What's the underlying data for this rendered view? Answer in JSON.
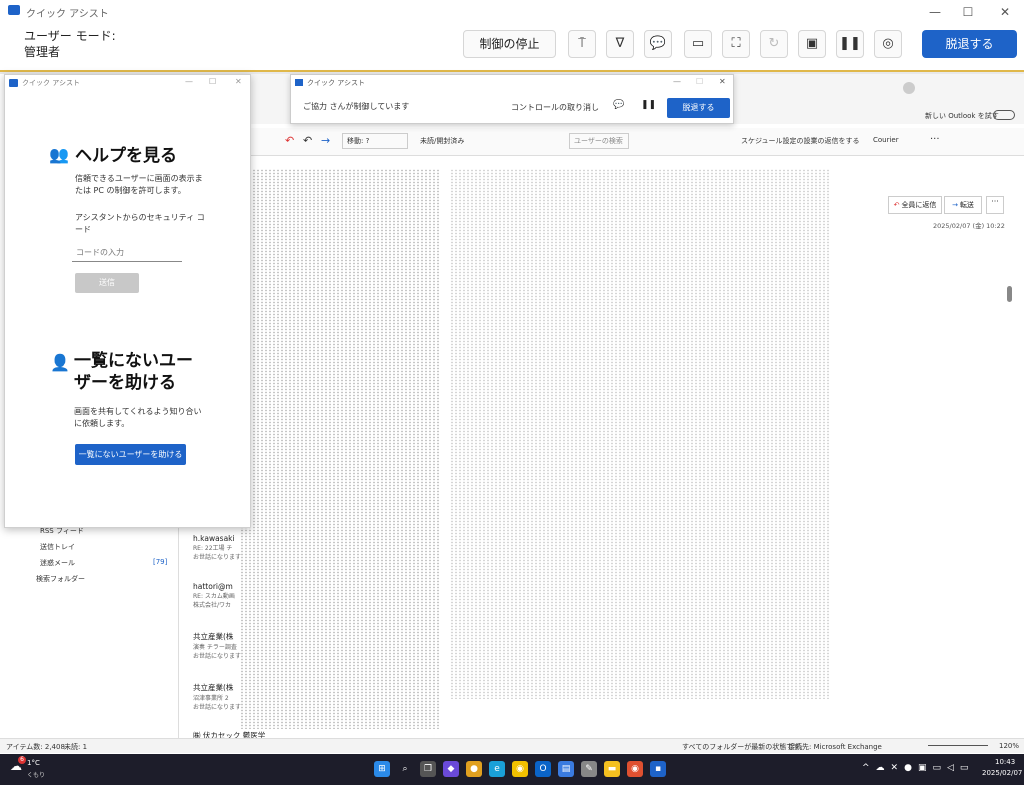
{
  "top_window": {
    "title": "クイック アシスト",
    "mode_label": "ユーザー モード:",
    "mode_value": "管理者",
    "stop_control": "制御の停止",
    "leave": "脱退する"
  },
  "help_panel": {
    "title": "クイック アシスト",
    "help_heading": "ヘルプを見る",
    "help_desc": "信頼できるユーザーに画面の表示または PC の制御を許可します。",
    "code_label": "アシスタントからのセキュリティ コード",
    "code_placeholder": "コードの入力",
    "submit": "送信",
    "unlisted_heading": "一覧にないユーザーを助ける",
    "unlisted_desc": "画面を共有してくれるよう知り合いに依頼します。",
    "unlisted_button": "一覧にないユーザーを助ける"
  },
  "inner_bar": {
    "title": "クイック アシスト",
    "status": "ご協力 さんが制御しています",
    "cancel_control": "コントロールの取り消し",
    "leave": "脱退する"
  },
  "outlook": {
    "try_new": "新しい Outlook を試す",
    "move_label": "移動: ?",
    "unread_read": "未読/開封済み",
    "search_user": "ユーザーの検索",
    "schedule_label": "スケジュール設定の設業の返信をする",
    "font": "Courier",
    "reply_all": "全員に返信",
    "forward": "転送",
    "date": "2025/02/07 (金) 10:22",
    "folders": [
      "RSS フィード",
      "送信トレイ",
      "迷惑メール",
      "検索フォルダー"
    ],
    "junk_count": "[79]",
    "messages": [
      {
        "from": "h.kawasaki",
        "sub": "RE: 22工場 チ",
        "body": "お世話になります"
      },
      {
        "from": "hattori@m",
        "sub": "RE: スカム動画",
        "body": "株式会社/ワカ"
      },
      {
        "from": "共立産業(株",
        "sub": "演奏 チラー調査",
        "body": "お世話になります"
      },
      {
        "from": "共立産業(株",
        "sub": "沼津事業所 2",
        "body": "お世話になります"
      },
      {
        "from": "㈱ 伏カセック 鬱医学",
        "sub": "",
        "body": ""
      }
    ],
    "status_items": "アイテム数: 2,408",
    "status_unread": "未読: 1",
    "status_sync": "すべてのフォルダーが最新の状態です。",
    "status_conn": "接続先: Microsoft Exchange",
    "zoom": "120%"
  },
  "taskbar": {
    "weather_temp": "1°C",
    "weather_desc": "くもり",
    "weather_badge": "6",
    "time": "10:43",
    "date": "2025/02/07"
  }
}
